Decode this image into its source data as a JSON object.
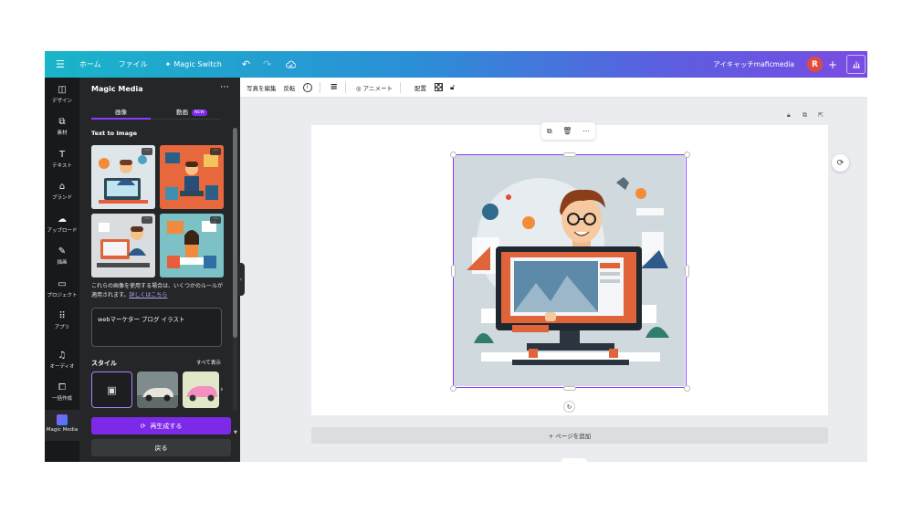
{
  "topbar": {
    "menu_icon": "hamburger-icon",
    "home": "ホーム",
    "file": "ファイル",
    "magic_switch": "Magic Switch",
    "design_title": "アイキャッチmaficmedia",
    "avatar_letter": "R"
  },
  "rail": {
    "items": [
      {
        "label": "デザイン",
        "icon": "layout-icon"
      },
      {
        "label": "素材",
        "icon": "shapes-icon"
      },
      {
        "label": "テキスト",
        "icon": "text-icon"
      },
      {
        "label": "ブランド",
        "icon": "brand-icon"
      },
      {
        "label": "アップロード",
        "icon": "upload-icon"
      },
      {
        "label": "描画",
        "icon": "draw-icon"
      },
      {
        "label": "プロジェクト",
        "icon": "folder-icon"
      },
      {
        "label": "アプリ",
        "icon": "apps-icon"
      },
      {
        "label": "オーディオ",
        "icon": "music-icon"
      },
      {
        "label": "一括作成",
        "icon": "bulk-create-icon"
      },
      {
        "label": "Magic Media",
        "icon": "magic-media-icon"
      }
    ]
  },
  "panel": {
    "title": "Magic Media",
    "tab_image": "画像",
    "tab_video": "動画",
    "new_badge": "NEW",
    "section_title": "Text to Image",
    "notice_text": "これらの画像を使用する場合は、いくつかのルールが適用されます。",
    "notice_link": "詳しくはこちら",
    "prompt_value": "webマーケター ブログ イラスト",
    "style_title": "スタイル",
    "see_all": "すべて表示",
    "regenerate": "再生成する",
    "back": "戻る"
  },
  "context_toolbar": {
    "edit_photo": "写真を編集",
    "flip": "反転",
    "animate": "アニメート",
    "position": "配置"
  },
  "canvas": {
    "add_page": "+ ページを追加"
  },
  "colors": {
    "accent": "#8b3dff",
    "purple_button": "#7d2ae8",
    "panel_bg": "#252627",
    "rail_bg": "#18191b"
  }
}
